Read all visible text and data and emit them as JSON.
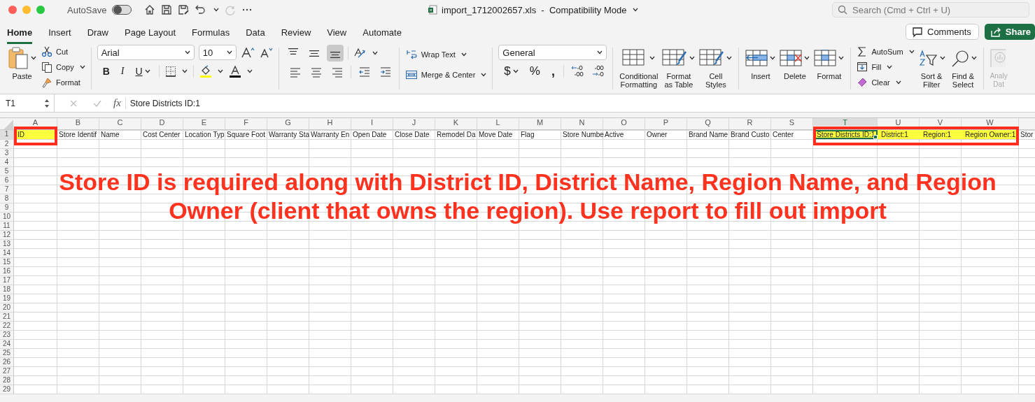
{
  "title_bar": {
    "autosave_label": "AutoSave",
    "autosave_on": false,
    "redo_disabled": true,
    "file_title": "import_1712002657.xls  -  Compatibility Mode",
    "search_placeholder": "Search (Cmd + Ctrl + U)"
  },
  "tabs": [
    {
      "label": "Home",
      "selected": true
    },
    {
      "label": "Insert",
      "selected": false
    },
    {
      "label": "Draw",
      "selected": false
    },
    {
      "label": "Page Layout",
      "selected": false
    },
    {
      "label": "Formulas",
      "selected": false
    },
    {
      "label": "Data",
      "selected": false
    },
    {
      "label": "Review",
      "selected": false
    },
    {
      "label": "View",
      "selected": false
    },
    {
      "label": "Automate",
      "selected": false
    }
  ],
  "header_buttons": [
    {
      "label": "Comments",
      "kind": "comments"
    },
    {
      "label": "Share",
      "kind": "share"
    }
  ],
  "ribbon": {
    "clipboard": {
      "paste": "Paste",
      "cut": "Cut",
      "copy": "Copy",
      "format": "Format"
    },
    "font": {
      "name": "Arial",
      "size": "10",
      "bold": "B",
      "italic": "I",
      "underline": "U"
    },
    "vertical_align": [
      {
        "kind": "top",
        "selected": false
      },
      {
        "kind": "middle",
        "selected": false
      },
      {
        "kind": "bottom",
        "selected": true
      }
    ],
    "wrap_text": "Wrap Text",
    "merge": "Merge & Center",
    "number": {
      "format": "General",
      "currency": "$",
      "percent": "%",
      "comma": ","
    },
    "styles": [
      {
        "label": "Conditional\nFormatting",
        "kind": "conditional"
      },
      {
        "label": "Format\nas Table",
        "kind": "table"
      },
      {
        "label": "Cell\nStyles",
        "kind": "cellstyles"
      }
    ],
    "cells": [
      {
        "label": "Insert",
        "kind": "insert"
      },
      {
        "label": "Delete",
        "kind": "delete"
      },
      {
        "label": "Format",
        "kind": "format"
      }
    ],
    "editing_small": [
      {
        "label": "AutoSum",
        "kind": "autosum"
      },
      {
        "label": "Fill",
        "kind": "fill"
      },
      {
        "label": "Clear",
        "kind": "clear"
      }
    ],
    "editing_large": [
      {
        "label": "Sort &\nFilter",
        "kind": "sort"
      },
      {
        "label": "Find &\nSelect",
        "kind": "find"
      }
    ],
    "analysis": {
      "label": "Analy\nDat",
      "disabled": true
    }
  },
  "formula_bar": {
    "name_box": "T1",
    "function_label": "fx",
    "formula": "Store Districts ID:1"
  },
  "sheet": {
    "columns": [
      {
        "letter": "A",
        "selected": false
      },
      {
        "letter": "B",
        "selected": false
      },
      {
        "letter": "C",
        "selected": false
      },
      {
        "letter": "D",
        "selected": false
      },
      {
        "letter": "E",
        "selected": false
      },
      {
        "letter": "F",
        "selected": false
      },
      {
        "letter": "G",
        "selected": false
      },
      {
        "letter": "H",
        "selected": false
      },
      {
        "letter": "I",
        "selected": false
      },
      {
        "letter": "J",
        "selected": false
      },
      {
        "letter": "K",
        "selected": false
      },
      {
        "letter": "L",
        "selected": false
      },
      {
        "letter": "M",
        "selected": false
      },
      {
        "letter": "N",
        "selected": false
      },
      {
        "letter": "O",
        "selected": false
      },
      {
        "letter": "P",
        "selected": false
      },
      {
        "letter": "Q",
        "selected": false
      },
      {
        "letter": "R",
        "selected": false
      },
      {
        "letter": "S",
        "selected": false
      },
      {
        "letter": "T",
        "selected": true
      },
      {
        "letter": "U",
        "selected": false
      },
      {
        "letter": "V",
        "selected": false
      },
      {
        "letter": "W",
        "selected": false
      }
    ],
    "rows": [
      {
        "label": "1",
        "selected": true
      },
      {
        "label": "2",
        "selected": false
      },
      {
        "label": "3",
        "selected": false
      },
      {
        "label": "4",
        "selected": false
      },
      {
        "label": "5",
        "selected": false
      },
      {
        "label": "6",
        "selected": false
      },
      {
        "label": "7",
        "selected": false
      },
      {
        "label": "8",
        "selected": false
      },
      {
        "label": "9",
        "selected": false
      },
      {
        "label": "10",
        "selected": false
      },
      {
        "label": "11",
        "selected": false
      },
      {
        "label": "12",
        "selected": false
      },
      {
        "label": "13",
        "selected": false
      },
      {
        "label": "14",
        "selected": false
      },
      {
        "label": "15",
        "selected": false
      },
      {
        "label": "16",
        "selected": false
      },
      {
        "label": "17",
        "selected": false
      },
      {
        "label": "18",
        "selected": false
      },
      {
        "label": "19",
        "selected": false
      },
      {
        "label": "20",
        "selected": false
      },
      {
        "label": "21",
        "selected": false
      },
      {
        "label": "22",
        "selected": false
      },
      {
        "label": "23",
        "selected": false
      },
      {
        "label": "24",
        "selected": false
      },
      {
        "label": "25",
        "selected": false
      },
      {
        "label": "26",
        "selected": false
      },
      {
        "label": "27",
        "selected": false
      },
      {
        "label": "28",
        "selected": false
      },
      {
        "label": "29",
        "selected": false
      }
    ],
    "row_1_cells": [
      {
        "text": "ID",
        "highlight": true,
        "selected": false,
        "framed": true
      },
      {
        "text": "Store Identif",
        "highlight": false,
        "selected": false
      },
      {
        "text": "Name",
        "highlight": false,
        "selected": false
      },
      {
        "text": "Cost Center",
        "highlight": false,
        "selected": false
      },
      {
        "text": "Location Typ",
        "highlight": false,
        "selected": false
      },
      {
        "text": "Square Foot",
        "highlight": false,
        "selected": false
      },
      {
        "text": "Warranty Sta",
        "highlight": false,
        "selected": false
      },
      {
        "text": "Warranty En",
        "highlight": false,
        "selected": false
      },
      {
        "text": "Open Date",
        "highlight": false,
        "selected": false
      },
      {
        "text": "Close Date",
        "highlight": false,
        "selected": false
      },
      {
        "text": "Remodel Da",
        "highlight": false,
        "selected": false
      },
      {
        "text": "Move Date",
        "highlight": false,
        "selected": false
      },
      {
        "text": "Flag",
        "highlight": false,
        "selected": false
      },
      {
        "text": "Store Numbe",
        "highlight": false,
        "selected": false
      },
      {
        "text": "Active",
        "highlight": false,
        "selected": false
      },
      {
        "text": "Owner",
        "highlight": false,
        "selected": false
      },
      {
        "text": "Brand Name",
        "highlight": false,
        "selected": false
      },
      {
        "text": "Brand Custo",
        "highlight": false,
        "selected": false
      },
      {
        "text": "Center",
        "highlight": false,
        "selected": false
      },
      {
        "text": "Store Districts ID:1",
        "highlight": true,
        "selected": true,
        "framed": true
      },
      {
        "text": "District:1",
        "highlight": true,
        "selected": false,
        "framed": true
      },
      {
        "text": "Region:1",
        "highlight": true,
        "selected": false,
        "framed": true
      },
      {
        "text": "Region Owner:1",
        "highlight": true,
        "selected": false,
        "framed": true
      },
      {
        "text": "Stor",
        "highlight": false,
        "selected": false
      }
    ]
  },
  "annotations": [
    {
      "kind": "note",
      "text": "Store ID is required along with District ID, District Name, Region Name, and Region Owner (client that owns the region). Use report to fill out import"
    }
  ]
}
